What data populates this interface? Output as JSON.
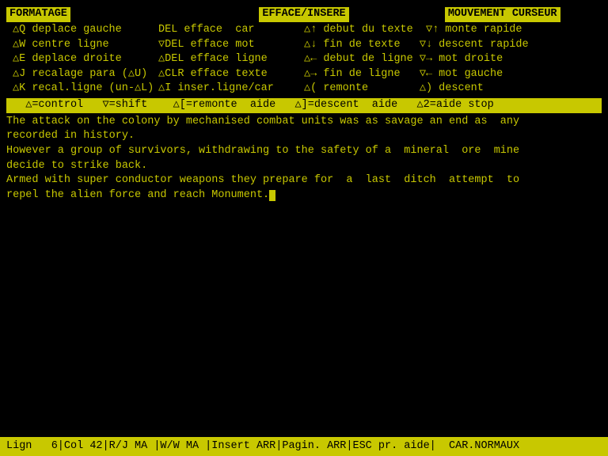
{
  "screen": {
    "background": "#000000",
    "foreground": "#c8c800"
  },
  "header": {
    "col1": "FORMATAGE",
    "col2": "EFFACE/INSERE",
    "col3": "MOUVEMENT CURSEUR"
  },
  "help_lines": {
    "col1": [
      "△Q deplace gauche",
      "△W centre ligne",
      "△E deplace droite",
      "△J recalage para (△U)",
      "△K recal.ligne (un-△L)"
    ],
    "col2": [
      "DEL efface  car",
      "▽DEL efface mot",
      "△DEL efface ligne",
      "△CLR efface texte",
      "△I inser.ligne/car"
    ],
    "col3": [
      "△↑ debut du texte  ▽↑ monte rapide",
      "△↓ fin de texte   ▽↓ descent rapide",
      "△← debut de ligne ▽→ mot droite",
      "△→ fin de ligne   ▽← mot gauche",
      "△( remonte        △) descent"
    ]
  },
  "highlight_bar": "  △=control   ▽=shift    △[=remonte  aide   △]=descent  aide   △2=aide stop",
  "text_lines": [
    "The attack on the colony by mechanised combat units was as savage an end as  any",
    "recorded in history.",
    "However a group of survivors, withdrawing to the safety of a  mineral  ore  mine",
    "decide to strike back.",
    "Armed with super conductor weapons they prepare for  a  last  ditch  attempt  to",
    "repel the alien force and reach Monument."
  ],
  "status_bar": "Lign   6|Col 42|R/J MA |W/W MA |Insert ARR|Pagin. ARR|ESC pr. aide|  CAR.NORMAUX"
}
